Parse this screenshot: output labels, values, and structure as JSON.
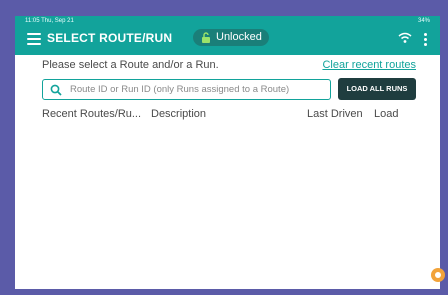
{
  "status_bar": {
    "left": "11:05 Thu, Sep 21",
    "right": "34%"
  },
  "header": {
    "title": "SELECT ROUTE/RUN",
    "lock_status": "Unlocked",
    "colors": {
      "accent": "#12a39b",
      "dark": "#1f3d3f"
    }
  },
  "main": {
    "prompt": "Please select a Route and/or a Run.",
    "clear_link": "Clear recent routes",
    "search": {
      "value": "",
      "placeholder": "Route ID or Run ID (only Runs assigned to a Route)"
    },
    "load_all_label": "LOAD ALL RUNS",
    "table_headers": [
      "Recent Routes/Ru...",
      "Description",
      "Last Driven",
      "Load"
    ]
  }
}
